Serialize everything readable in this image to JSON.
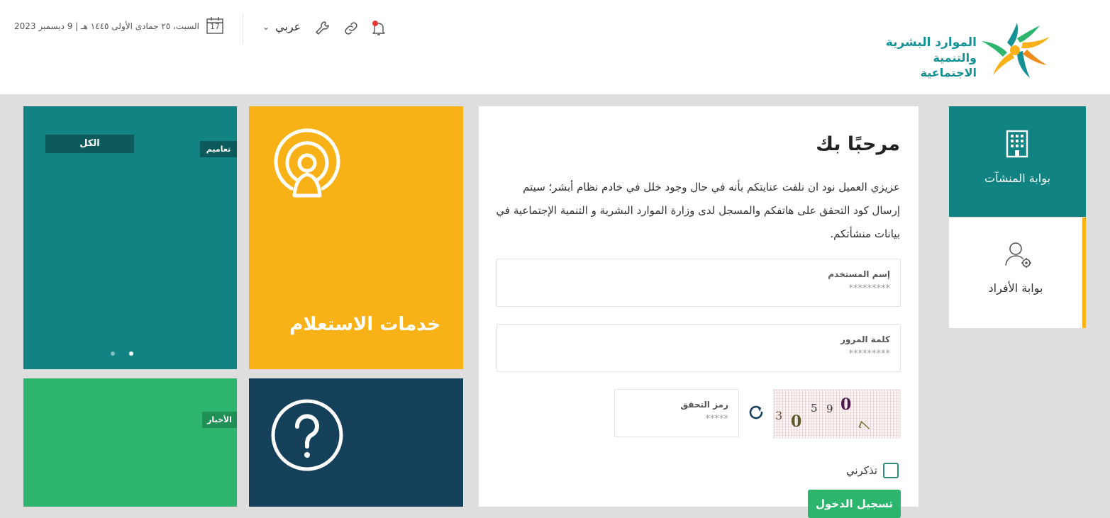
{
  "header": {
    "logo_line1": "الموارد البشرية",
    "logo_line2": "والتنمية الاجتماعية",
    "date_text": "السبت، ٢٥ جمادى الأولى ١٤٤٥ هـ | 9 ديسمبر 2023",
    "calendar_day": "17",
    "language_label": "عربي",
    "icons": [
      "calendar-icon",
      "chevron-down-icon",
      "wrench-icon",
      "link-icon",
      "bell-icon"
    ],
    "brand_color": "#139195"
  },
  "tiles": {
    "teal": {
      "all_button": "الكل",
      "tag": "تعاميم",
      "color": "#128383",
      "carousel": {
        "count": 2,
        "active": 1
      }
    },
    "inquiry": {
      "title": "خدمات الاستعلام",
      "icon": "person-broadcast-icon",
      "color": "#f8b218"
    },
    "news": {
      "tag": "الأخبار",
      "color": "#2db56d"
    },
    "help": {
      "icon": "question-circle-icon",
      "color": "#14405a"
    }
  },
  "login": {
    "welcome": "مرحبًا بك",
    "intro": "عزيزي العميل نود ان نلفت عنايتكم بأنه في حال وجود خلل في خادم نظام أبشر؛ سيتم إرسال كود التحقق على هاتفكم والمسجل لدى وزارة الموارد البشرية و التنمية الإجتماعية في بيانات منشأتكم.",
    "username_label": "إسم المستخدم",
    "username_placeholder": "*********",
    "password_label": "كلمة المرور",
    "password_placeholder": "*********",
    "captcha_label": "رمز التحقق",
    "captcha_placeholder": "*****",
    "captcha_chars": [
      "3",
      "0",
      "5",
      "9",
      "0",
      "7"
    ],
    "remember_label": "تذكرني",
    "login_button": "تسجيل الدخول"
  },
  "portals": [
    {
      "label": "بوابة المنشآت",
      "icon": "building-icon",
      "active": true
    },
    {
      "label": "بوابة الأفراد",
      "icon": "user-gear-icon",
      "active": false
    }
  ]
}
